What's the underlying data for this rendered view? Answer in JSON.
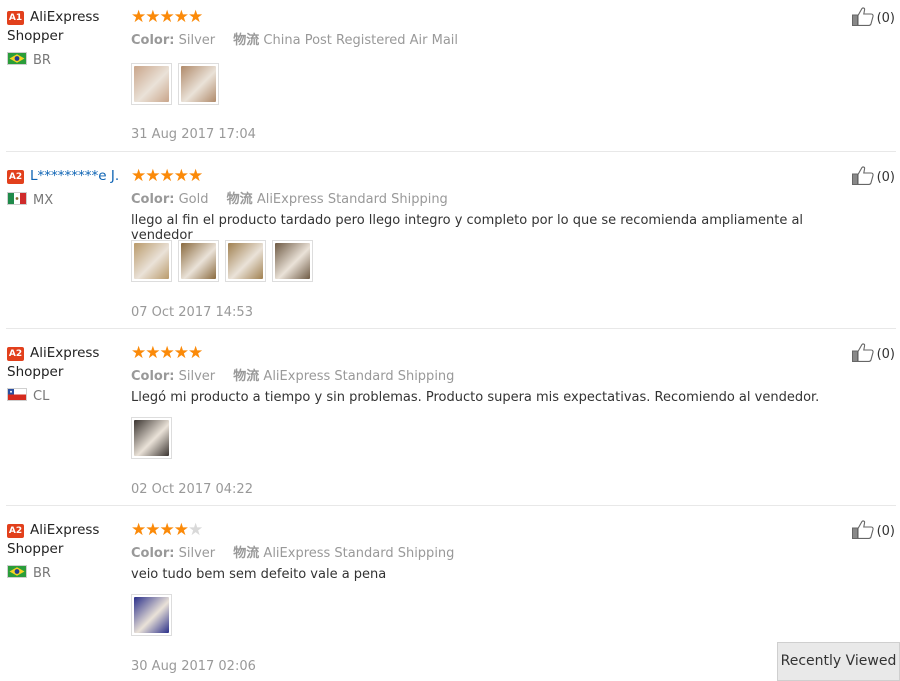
{
  "reviews": [
    {
      "level": "A1",
      "username": "AliExpress Shopper",
      "country": "BR",
      "stars": 5,
      "color_label": "Color:",
      "color_value": "Silver",
      "shipping_label": "物流",
      "shipping_value": "China Post Registered Air Mail",
      "feedback": "",
      "date": "31 Aug 2017 17:04",
      "useful_count": "(0)",
      "photos": [
        "#c9a58a",
        "#b08a6a"
      ]
    },
    {
      "level": "A2",
      "username": "L*********e J.",
      "country": "MX",
      "stars": 5,
      "color_label": "Color:",
      "color_value": "Gold",
      "shipping_label": "物流",
      "shipping_value": "AliExpress Standard Shipping",
      "feedback": "llego al fin el producto tardado pero llego integro y completo por lo que se recomienda ampliamente al vendedor",
      "date": "07 Oct 2017 14:53",
      "useful_count": "(0)",
      "photos": [
        "#b99a6a",
        "#8a6a3e",
        "#a08050",
        "#6e5a44"
      ]
    },
    {
      "level": "A2",
      "username": "AliExpress Shopper",
      "country": "CL",
      "stars": 5,
      "color_label": "Color:",
      "color_value": "Silver",
      "shipping_label": "物流",
      "shipping_value": "AliExpress Standard Shipping",
      "feedback": "Llegó mi producto a tiempo y sin problemas. Producto supera mis expectativas. Recomiendo al vendedor.",
      "date": "02 Oct 2017 04:22",
      "useful_count": "(0)",
      "photos": [
        "#3a3430"
      ]
    },
    {
      "level": "A2",
      "username": "AliExpress Shopper",
      "country": "BR",
      "stars": 4,
      "color_label": "Color:",
      "color_value": "Silver",
      "shipping_label": "物流",
      "shipping_value": "AliExpress Standard Shipping",
      "feedback": "veio tudo bem sem defeito vale a pena",
      "date": "30 Aug 2017 02:06",
      "useful_count": "(0)",
      "photos": [
        "#2a2f8a"
      ]
    }
  ],
  "recently_viewed": "Recently Viewed",
  "colors": {
    "star": "#fb8a09",
    "level_badge": "#e2401c",
    "link": "#0d63b4"
  }
}
